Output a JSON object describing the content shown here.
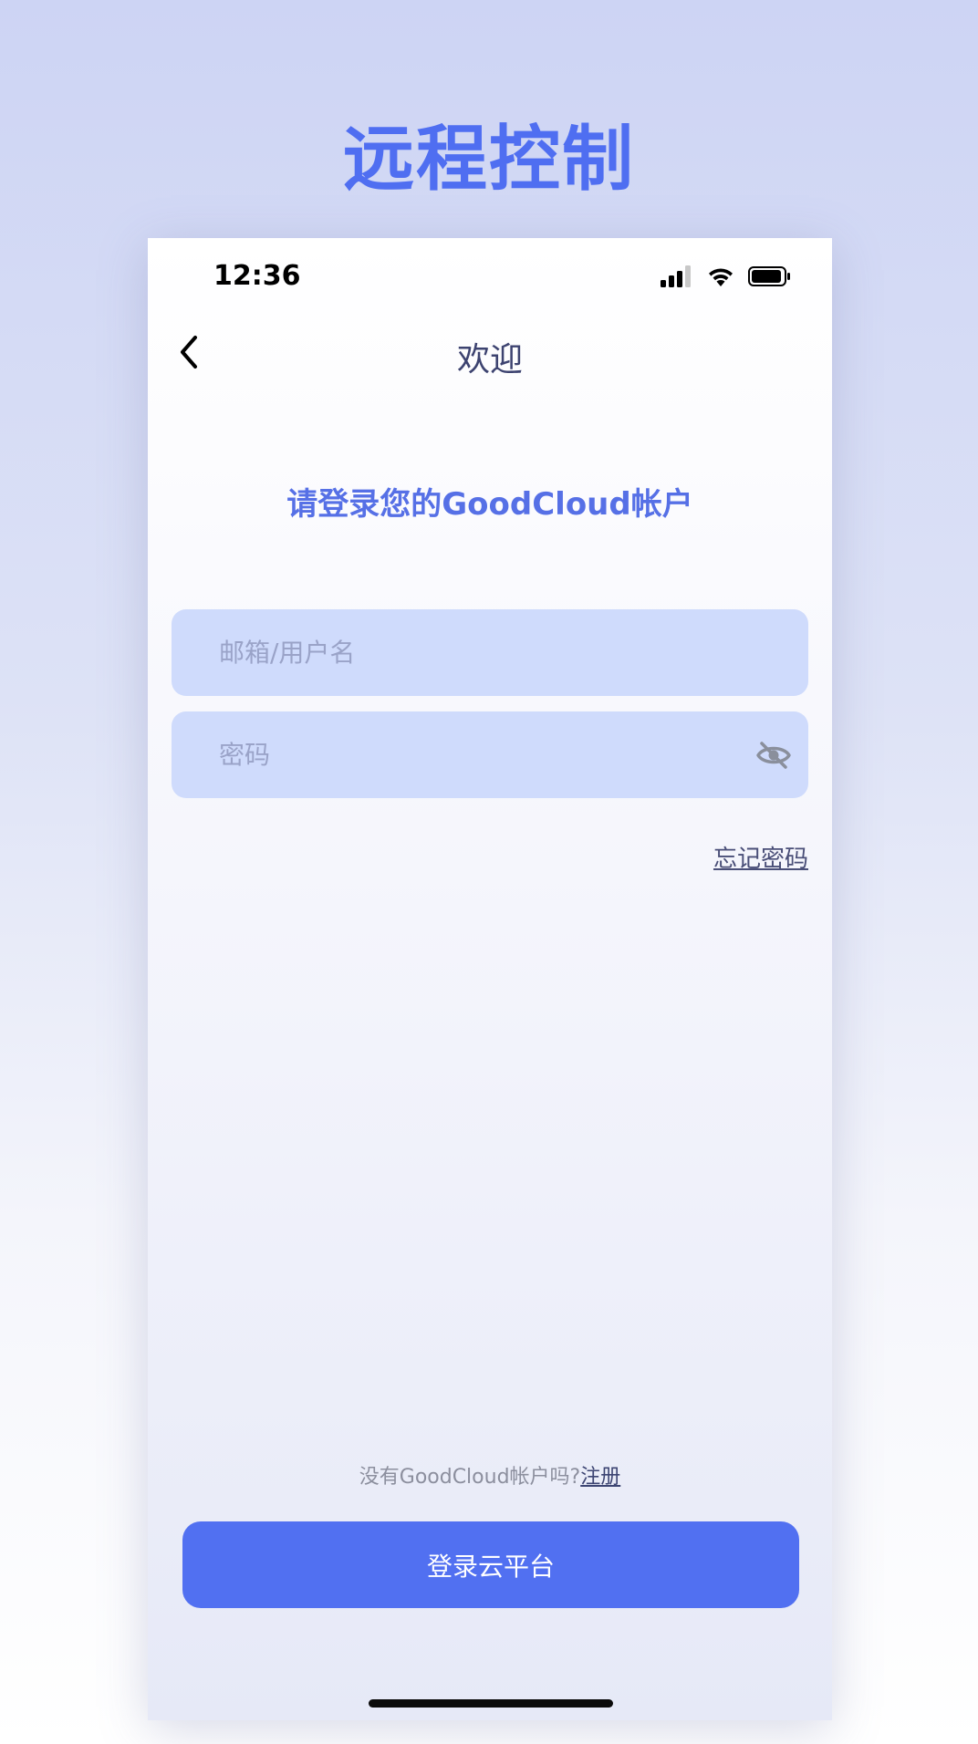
{
  "promo": {
    "title": "远程控制"
  },
  "status_bar": {
    "time": "12:36",
    "icons": [
      "cellular-signal-icon",
      "wifi-icon",
      "battery-icon"
    ]
  },
  "nav": {
    "back_icon": "chevron-left-icon",
    "title": "欢迎"
  },
  "login": {
    "heading": "请登录您的GoodCloud帐户",
    "username_placeholder": "邮箱/用户名",
    "username_value": "",
    "password_placeholder": "密码",
    "password_value": "",
    "password_toggle_icon": "eye-slash-icon",
    "forgot_password": "忘记密码",
    "register_prompt": "没有GoodCloud帐户吗?",
    "register_link": "注册",
    "submit_label": "登录云平台"
  },
  "colors": {
    "accent": "#5170f1",
    "heading": "#5670e6",
    "field_bg": "#cfdbfc",
    "nav_title": "#3d4370"
  }
}
